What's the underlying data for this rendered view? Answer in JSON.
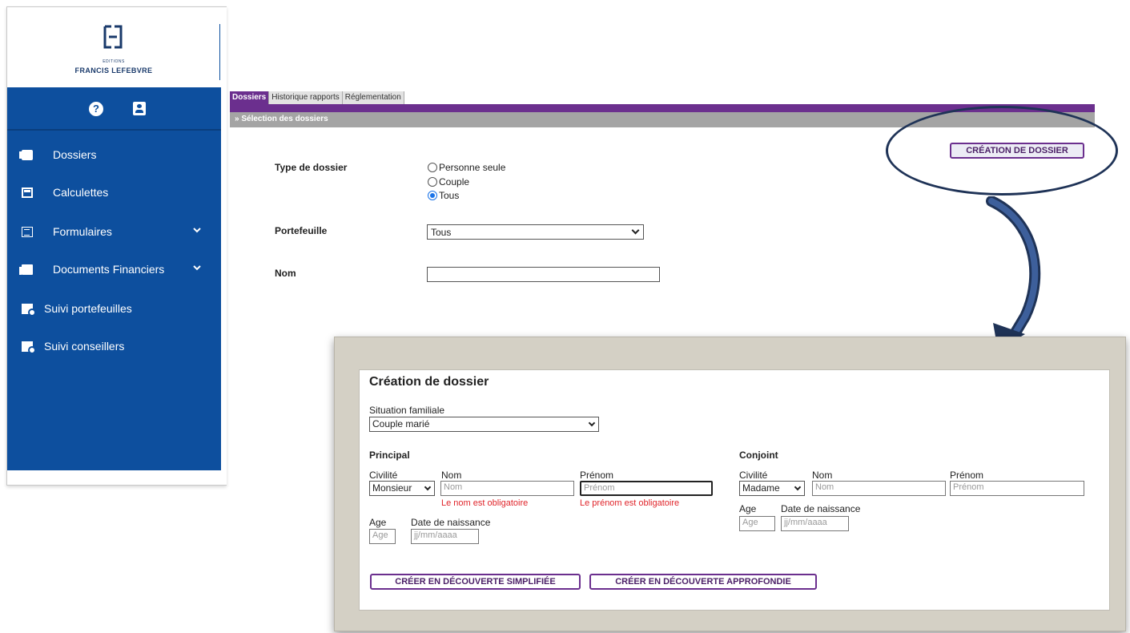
{
  "logo": {
    "small": "EDITIONS",
    "big": "FRANCIS LEFEBVRE"
  },
  "sidebar": {
    "items": [
      {
        "label": "Dossiers",
        "icon": "folder-icon"
      },
      {
        "label": "Calculettes",
        "icon": "calculator-icon"
      },
      {
        "label": "Formulaires",
        "icon": "form-icon",
        "expandable": true
      },
      {
        "label": "Documents Financiers",
        "icon": "documents-icon",
        "expandable": true
      },
      {
        "label": "Suivi portefeuilles",
        "icon": "search-doc-icon"
      },
      {
        "label": "Suivi conseillers",
        "icon": "search-doc-icon"
      }
    ]
  },
  "tabs": [
    "Dossiers",
    "Historique rapports",
    "Réglementation"
  ],
  "section_title": "» Sélection des dossiers",
  "filters": {
    "type_label": "Type de dossier",
    "type_options": [
      "Personne seule",
      "Couple",
      "Tous"
    ],
    "type_selected": "Tous",
    "portefeuille_label": "Portefeuille",
    "portefeuille_value": "Tous",
    "nom_label": "Nom",
    "nom_value": ""
  },
  "create_button": "CRÉATION DE DOSSIER",
  "modal": {
    "title": "Création de dossier",
    "situation_label": "Situation familiale",
    "situation_value": "Couple marié",
    "principal": {
      "heading": "Principal",
      "civilite_label": "Civilité",
      "civilite_value": "Monsieur",
      "nom_label": "Nom",
      "nom_placeholder": "Nom",
      "nom_error": "Le nom est obligatoire",
      "prenom_label": "Prénom",
      "prenom_placeholder": "Prénom",
      "prenom_error": "Le prénom est obligatoire",
      "age_label": "Age",
      "age_placeholder": "Age",
      "dob_label": "Date de naissance",
      "dob_placeholder": "jj/mm/aaaa"
    },
    "conjoint": {
      "heading": "Conjoint",
      "civilite_label": "Civilité",
      "civilite_value": "Madame",
      "nom_label": "Nom",
      "nom_placeholder": "Nom",
      "prenom_label": "Prénom",
      "prenom_placeholder": "Prénom",
      "age_label": "Age",
      "age_placeholder": "Age",
      "dob_label": "Date de naissance",
      "dob_placeholder": "jj/mm/aaaa"
    },
    "btn_simplifiee": "CRÉER EN DÉCOUVERTE SIMPLIFIÉE",
    "btn_approfondie": "CRÉER EN DÉCOUVERTE APPROFONDIE"
  },
  "colors": {
    "sidebar": "#0d4f9e",
    "accent_purple": "#6b2f8e",
    "error_red": "#e0242a",
    "annotation_navy": "#1f3357"
  }
}
